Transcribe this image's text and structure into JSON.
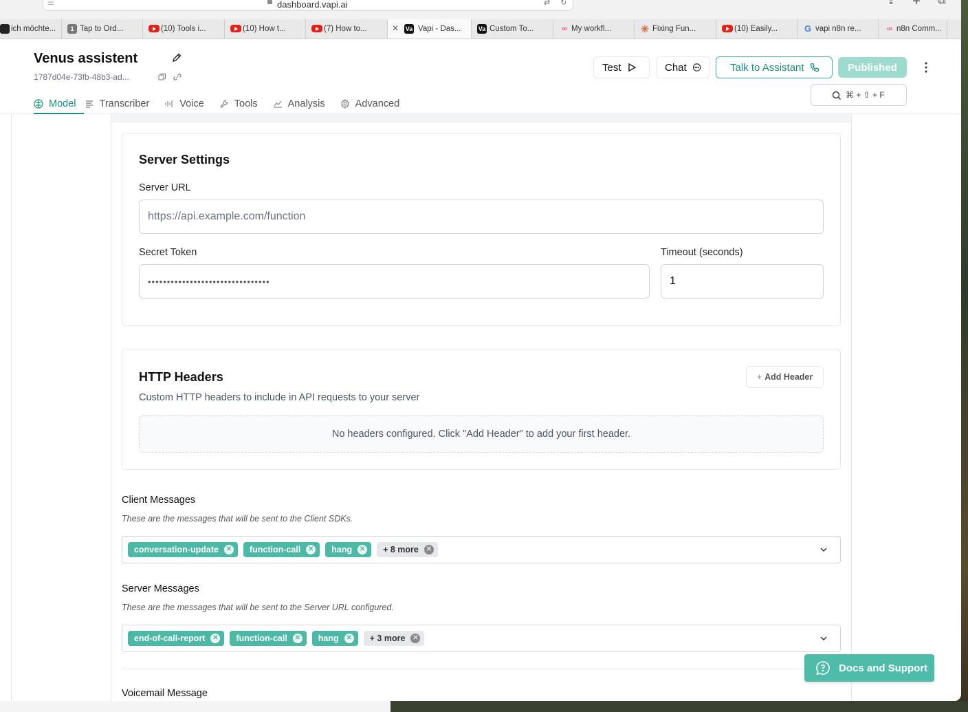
{
  "browser": {
    "url": "dashboard.vapi.ai",
    "tabs": [
      {
        "label": "ich möchte...",
        "favicon": "dark-icon",
        "active": false
      },
      {
        "label": "Tap to Ord...",
        "favicon": "number-one-icon",
        "active": false
      },
      {
        "label": "(10) Tools i...",
        "favicon": "youtube-icon",
        "active": false
      },
      {
        "label": "(10) How t...",
        "favicon": "youtube-icon",
        "active": false
      },
      {
        "label": "(7) How to...",
        "favicon": "youtube-icon",
        "active": false
      },
      {
        "label": "Vapi - Das...",
        "favicon": "vapi-icon",
        "active": true
      },
      {
        "label": "Custom To...",
        "favicon": "vapi-icon",
        "active": false
      },
      {
        "label": "My workfl...",
        "favicon": "n8n-icon",
        "active": false
      },
      {
        "label": "Fixing Fun...",
        "favicon": "claude-spark-icon",
        "active": false
      },
      {
        "label": "(10) Easily...",
        "favicon": "youtube-icon",
        "active": false
      },
      {
        "label": "vapi n8n re...",
        "favicon": "google-icon",
        "active": false
      },
      {
        "label": "n8n Comm...",
        "favicon": "n8n-icon",
        "active": false
      }
    ]
  },
  "header": {
    "assistant_name": "Venus assistent",
    "assistant_id": "1787d04e-73fb-48b3-ad...",
    "test_label": "Test",
    "chat_label": "Chat",
    "talk_label": "Talk to Assistant",
    "publish_label": "Published",
    "search_shortcut": "⌘ + ⇧ + F"
  },
  "tabs": [
    {
      "label": "Model",
      "icon": "brain-icon",
      "active": true
    },
    {
      "label": "Transcriber",
      "icon": "lines-icon",
      "active": false
    },
    {
      "label": "Voice",
      "icon": "waveform-icon",
      "active": false
    },
    {
      "label": "Tools",
      "icon": "wrench-icon",
      "active": false
    },
    {
      "label": "Analysis",
      "icon": "chart-line-icon",
      "active": false
    },
    {
      "label": "Advanced",
      "icon": "gear-icon",
      "active": false
    }
  ],
  "server_settings": {
    "title": "Server Settings",
    "server_url_label": "Server URL",
    "server_url_placeholder": "https://api.example.com/function",
    "secret_token_label": "Secret Token",
    "secret_token_value": "••••••••••••••••••••••••••••••••",
    "timeout_label": "Timeout (seconds)",
    "timeout_value": "1"
  },
  "http_headers": {
    "title": "HTTP Headers",
    "add_label": "Add Header",
    "description": "Custom HTTP headers to include in API requests to your server",
    "empty_text": "No headers configured. Click \"Add Header\" to add your first header."
  },
  "client_messages": {
    "label": "Client Messages",
    "description": "These are the messages that will be sent to the Client SDKs.",
    "chips": [
      "conversation-update",
      "function-call",
      "hang"
    ],
    "more": "+ 8 more"
  },
  "server_messages": {
    "label": "Server Messages",
    "description": "These are the messages that will be sent to the Server URL configured.",
    "chips": [
      "end-of-call-report",
      "function-call",
      "hang"
    ],
    "more": "+ 3 more"
  },
  "voicemail": {
    "label": "Voicemail Message"
  },
  "docs_support_label": "Docs and Support",
  "colors": {
    "accent": "#16917c",
    "chip": "#4bb9a5",
    "published": "#9ddbcf"
  }
}
